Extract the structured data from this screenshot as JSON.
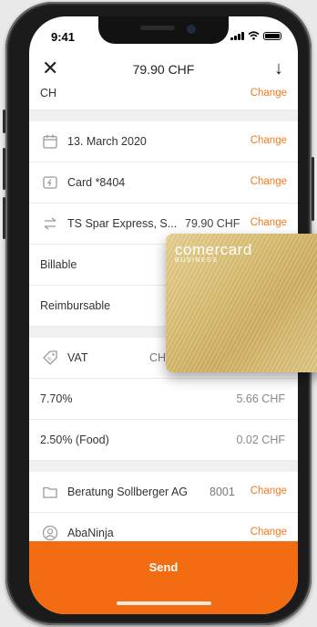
{
  "status": {
    "time": "9:41"
  },
  "header": {
    "title": "79.90 CHF",
    "close_icon": "close-icon",
    "download_icon": "arrow-down-icon"
  },
  "rows": {
    "partial": {
      "label": "CH",
      "action": "Change"
    },
    "date": {
      "icon": "calendar-icon",
      "label": "13. March 2020",
      "action": "Change"
    },
    "card": {
      "icon": "card-icon",
      "label": "Card *8404",
      "action": "Change"
    },
    "merchant": {
      "icon": "transfer-arrows-icon",
      "label": "TS Spar Express, S...",
      "amount": "79.90 CHF",
      "action": "Change"
    },
    "billable": {
      "label": "Billable"
    },
    "reimbursable": {
      "label": "Reimbursable"
    },
    "vat": {
      "icon": "tag-icon",
      "label": "VAT",
      "currency": "CH"
    },
    "vat_lines": [
      {
        "label": "7.70%",
        "value": "5.66 CHF"
      },
      {
        "label": "2.50% (Food)",
        "value": "0.02 CHF"
      }
    ],
    "project": {
      "icon": "folder-icon",
      "label": "Beratung Sollberger AG",
      "code": "8001",
      "action": "Change"
    },
    "contact": {
      "icon": "user-icon",
      "label": "AbaNinja",
      "action": "Change"
    }
  },
  "send": {
    "label": "Send"
  },
  "card_overlay": {
    "brand": "comercard",
    "sub": "BUSINESS"
  },
  "colors": {
    "accent": "#f07a1d",
    "send_bg": "#f36c12"
  }
}
